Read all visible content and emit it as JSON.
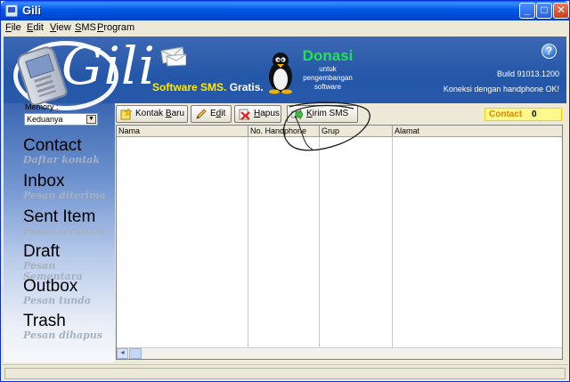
{
  "window": {
    "title": "Gili"
  },
  "titlebar_buttons": {
    "minimize": "_",
    "maximize": "□",
    "close": "✕"
  },
  "menu": [
    "File",
    "Edit",
    "View",
    "SMS",
    "Program"
  ],
  "header": {
    "logo_text": "Gili",
    "tagline_1": "Software SMS.",
    "tagline_2": "Gratis.",
    "donasi_title": "Donasi",
    "donasi_sub": [
      "untuk",
      "pengembangan",
      "software"
    ],
    "help_glyph": "?",
    "build": "Build 91013.1200",
    "koneksi": "Koneksi dengan handphone OK!"
  },
  "memory": {
    "label": "Memory :",
    "value": "Keduanya",
    "arrow": "▼"
  },
  "nav": [
    {
      "title": "Contact",
      "subtitle": "Daftar kontak"
    },
    {
      "title": "Inbox",
      "subtitle": "Pesan diterima"
    },
    {
      "title": "Sent Item",
      "subtitle": "Pesan terkirim"
    },
    {
      "title": "Draft",
      "subtitle": "Pesan Sementara"
    },
    {
      "title": "Outbox",
      "subtitle": "Pesan tunda"
    },
    {
      "title": "Trash",
      "subtitle": "Pesan dihapus"
    }
  ],
  "toolbar": {
    "kontak_baru": {
      "pre": "Kontak ",
      "ul": "B",
      "post": "aru"
    },
    "edit": {
      "pre": "E",
      "ul": "d",
      "post": "it"
    },
    "hapus": {
      "pre": "",
      "ul": "H",
      "post": "apus"
    },
    "kirim_sms": {
      "pre": "",
      "ul": "K",
      "post": "irim SMS"
    }
  },
  "contact_counter": {
    "label": "Contact",
    "value": "0"
  },
  "table": {
    "columns": [
      "Nama",
      "No. Handphone",
      "Grup",
      "Alamat"
    ]
  },
  "scroll": {
    "left_arrow": "◄"
  },
  "colors": {
    "header_blue": "#2457a8",
    "donasi_green": "#22e34d",
    "tagline_yellow": "#ffea00",
    "contact_bg": "#fff88c"
  }
}
